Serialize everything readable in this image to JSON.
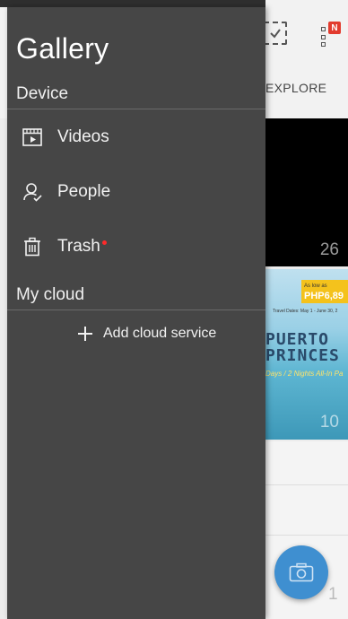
{
  "drawer": {
    "title": "Gallery",
    "sections": [
      {
        "header": "Device"
      },
      {
        "header": "My cloud"
      }
    ],
    "device_items": [
      {
        "label": "Videos",
        "icon": "video-icon"
      },
      {
        "label": "People",
        "icon": "person-icon"
      },
      {
        "label": "Trash",
        "icon": "trash-icon",
        "has_notification_dot": true
      }
    ],
    "add_cloud_label": "Add cloud service"
  },
  "background": {
    "tab_label": "EXPLORE",
    "news_badge": "N",
    "album_counts": [
      "26",
      "10",
      "1"
    ],
    "promo": {
      "price_top": "As low as",
      "price": "PHP6,89",
      "subtitle": "Travel Dates: May 1 - June 30, 2",
      "title_line1": "PUERTO",
      "title_line2": "PRINCES",
      "tagline": "Days / 2 Nights All-In Pa"
    }
  },
  "colors": {
    "drawer_bg": "#464646",
    "fab": "#3f8fd0",
    "notification_dot": "#ff2a2a"
  }
}
